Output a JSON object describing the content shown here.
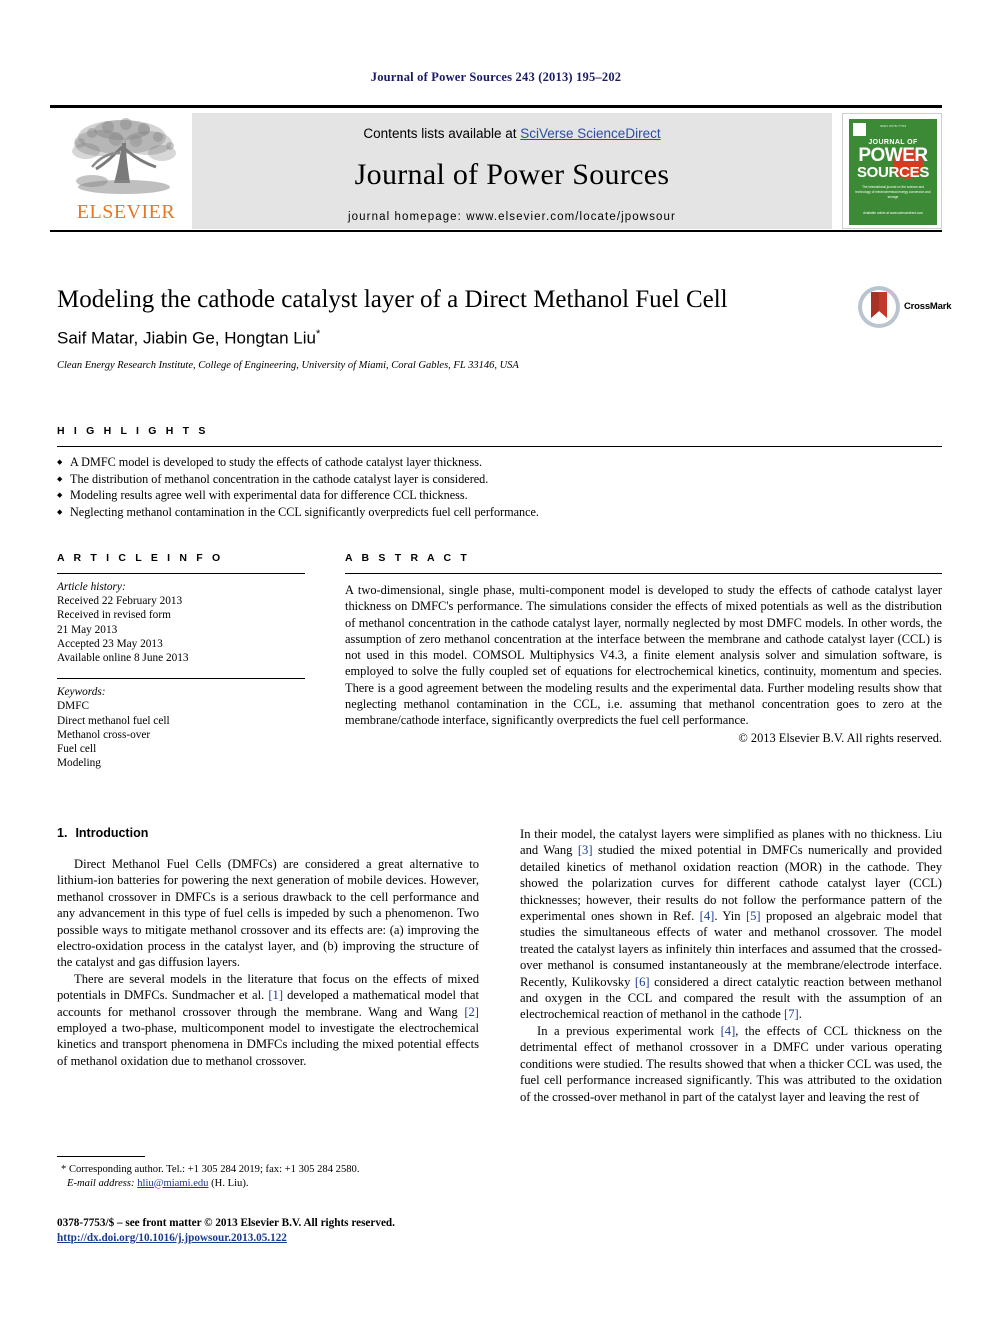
{
  "running_head": "Journal of Power Sources 243 (2013) 195–202",
  "masthead": {
    "contents_prefix": "Contents lists available at ",
    "sciencedirect": "SciVerse ScienceDirect",
    "journal_title": "Journal of Power Sources",
    "homepage": "journal homepage: www.elsevier.com/locate/jpowsour",
    "publisher_word": "ELSEVIER",
    "publisher_color": "#e87722",
    "banner_bg": "#e4e4e4",
    "link_color": "#2b4ea2",
    "cover": {
      "top_text": "ISSN 0378-7753",
      "journal_of": "JOURNAL OF",
      "power": "POWER",
      "sources": "SOURCES",
      "subtitle": "The international journal on the science and technology of electrochemical energy conversion and storage",
      "bottom": "Available online at www.sciencedirect.com",
      "bg_color": "#3c8a35",
      "accent_color": "#d63b1f"
    }
  },
  "article": {
    "title": "Modeling the cathode catalyst layer of a Direct Methanol Fuel Cell",
    "authors": "Saif Matar, Jiabin Ge, Hongtan Liu",
    "corresponding_marker": "*",
    "affiliation": "Clean Energy Research Institute, College of Engineering, University of Miami, Coral Gables, FL 33146, USA",
    "crossmark_label": "CrossMark"
  },
  "highlights": {
    "heading": "H I G H L I G H T S",
    "items": [
      "A DMFC model is developed to study the effects of cathode catalyst layer thickness.",
      "The distribution of methanol concentration in the cathode catalyst layer is considered.",
      "Modeling results agree well with experimental data for difference CCL thickness.",
      "Neglecting methanol contamination in the CCL significantly overpredicts fuel cell performance."
    ]
  },
  "article_info": {
    "heading": "A R T I C L E   I N F O",
    "history_label": "Article history:",
    "history": [
      "Received 22 February 2013",
      "Received in revised form",
      "21 May 2013",
      "Accepted 23 May 2013",
      "Available online 8 June 2013"
    ],
    "keywords_label": "Keywords:",
    "keywords": [
      "DMFC",
      "Direct methanol fuel cell",
      "Methanol cross-over",
      "Fuel cell",
      "Modeling"
    ]
  },
  "abstract": {
    "heading": "A B S T R A C T",
    "text": "A two-dimensional, single phase, multi-component model is developed to study the effects of cathode catalyst layer thickness on DMFC's performance. The simulations consider the effects of mixed potentials as well as the distribution of methanol concentration in the cathode catalyst layer, normally neglected by most DMFC models. In other words, the assumption of zero methanol concentration at the interface between the membrane and cathode catalyst layer (CCL) is not used in this model. COMSOL Multiphysics V4.3, a finite element analysis solver and simulation software, is employed to solve the fully coupled set of equations for electrochemical kinetics, continuity, momentum and species. There is a good agreement between the modeling results and the experimental data. Further modeling results show that neglecting methanol contamination in the CCL, i.e. assuming that methanol concentration goes to zero at the membrane/cathode interface, significantly overpredicts the fuel cell performance.",
    "copyright": "© 2013 Elsevier B.V. All rights reserved."
  },
  "body": {
    "section_number": "1.",
    "section_title": "Introduction",
    "left_paragraphs": [
      "Direct Methanol Fuel Cells (DMFCs) are considered a great alternative to lithium-ion batteries for powering the next generation of mobile devices. However, methanol crossover in DMFCs is a serious drawback to the cell performance and any advancement in this type of fuel cells is impeded by such a phenomenon. Two possible ways to mitigate methanol crossover and its effects are: (a) improving the electro-oxidation process in the catalyst layer, and (b) improving the structure of the catalyst and gas diffusion layers."
    ],
    "left_paragraph2_parts": [
      {
        "t": "There are several models in the literature that focus on the effects of mixed potentials in DMFCs. Sundmacher et al. ",
        "ref": false
      },
      {
        "t": "[1]",
        "ref": true
      },
      {
        "t": " developed a mathematical model that accounts for methanol crossover through the membrane. Wang and Wang ",
        "ref": false
      },
      {
        "t": "[2]",
        "ref": true
      },
      {
        "t": " employed a two-phase, multicomponent model to investigate the electrochemical kinetics and transport phenomena in DMFCs including the mixed potential effects of methanol oxidation due to methanol crossover.",
        "ref": false
      }
    ],
    "right_paragraph1_parts": [
      {
        "t": "In their model, the catalyst layers were simplified as planes with no thickness. Liu and Wang ",
        "ref": false
      },
      {
        "t": "[3]",
        "ref": true
      },
      {
        "t": " studied the mixed potential in DMFCs numerically and provided detailed kinetics of methanol oxidation reaction (MOR) in the cathode. They showed the polarization curves for different cathode catalyst layer (CCL) thicknesses; however, their results do not follow the performance pattern of the experimental ones shown in Ref. ",
        "ref": false
      },
      {
        "t": "[4]",
        "ref": true
      },
      {
        "t": ". Yin ",
        "ref": false
      },
      {
        "t": "[5]",
        "ref": true
      },
      {
        "t": " proposed an algebraic model that studies the simultaneous effects of water and methanol crossover. The model treated the catalyst layers as infinitely thin interfaces and assumed that the crossed-over methanol is consumed instantaneously at the membrane/electrode interface. Recently, Kulikovsky ",
        "ref": false
      },
      {
        "t": "[6]",
        "ref": true
      },
      {
        "t": " considered a direct catalytic reaction between methanol and oxygen in the CCL and compared the result with the assumption of an electrochemical reaction of methanol in the cathode ",
        "ref": false
      },
      {
        "t": "[7]",
        "ref": true
      },
      {
        "t": ".",
        "ref": false
      }
    ],
    "right_paragraph2_parts": [
      {
        "t": "In a previous experimental work ",
        "ref": false
      },
      {
        "t": "[4]",
        "ref": true
      },
      {
        "t": ", the effects of CCL thickness on the detrimental effect of methanol crossover in a DMFC under various operating conditions were studied. The results showed that when a thicker CCL was used, the fuel cell performance increased significantly. This was attributed to the oxidation of the crossed-over methanol in part of the catalyst layer and leaving the rest of",
        "ref": false
      }
    ]
  },
  "footnote": {
    "corresponding": "* Corresponding author. Tel.: +1 305 284 2019; fax: +1 305 284 2580.",
    "email_label": "E-mail address:",
    "email": "hliu@miami.edu",
    "email_suffix": "(H. Liu)."
  },
  "footer": {
    "issn_line": "0378-7753/$ – see front matter © 2013 Elsevier B.V. All rights reserved.",
    "doi": "http://dx.doi.org/10.1016/j.jpowsour.2013.05.122",
    "link_color": "#1a3a8f"
  }
}
